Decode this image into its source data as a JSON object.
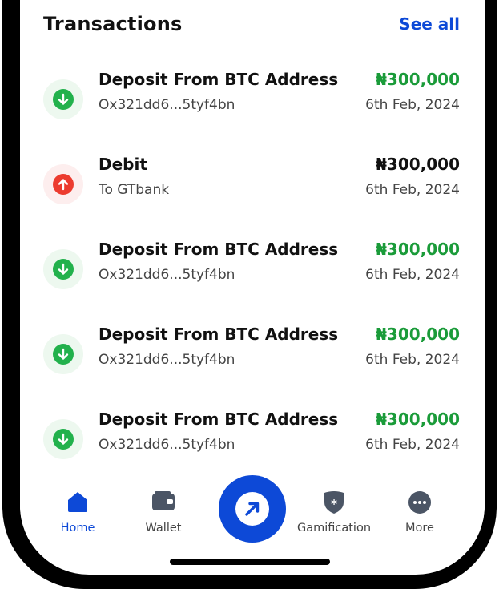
{
  "section": {
    "title": "Transactions",
    "see_all": "See all"
  },
  "transactions": [
    {
      "name": "Deposit From BTC Address",
      "sub": "Ox321dd6...5tyf4bn",
      "amount": "₦300,000",
      "date": "6th Feb, 2024",
      "direction": "in"
    },
    {
      "name": "Debit",
      "sub": "To GTbank",
      "amount": "₦300,000",
      "date": "6th Feb, 2024",
      "direction": "out"
    },
    {
      "name": "Deposit From BTC Address",
      "sub": "Ox321dd6...5tyf4bn",
      "amount": "₦300,000",
      "date": "6th Feb, 2024",
      "direction": "in"
    },
    {
      "name": "Deposit From BTC Address",
      "sub": "Ox321dd6...5tyf4bn",
      "amount": "₦300,000",
      "date": "6th Feb, 2024",
      "direction": "in"
    },
    {
      "name": "Deposit From BTC Address",
      "sub": "Ox321dd6...5tyf4bn",
      "amount": "₦300,000",
      "date": "6th Feb, 2024",
      "direction": "in"
    }
  ],
  "nav": {
    "home": "Home",
    "wallet": "Wallet",
    "gamification": "Gamification",
    "more": "More"
  },
  "colors": {
    "accent": "#0d49d7",
    "credit": "#1a9b39",
    "debit_icon": "#ec3b2f",
    "credit_icon": "#22b14c"
  },
  "icons": {
    "credit": "arrow-down-icon",
    "debit": "arrow-up-icon",
    "home": "home-icon",
    "wallet": "wallet-icon",
    "fab": "send-arrow-icon",
    "gamification": "shield-star-icon",
    "more": "more-dots-icon"
  }
}
